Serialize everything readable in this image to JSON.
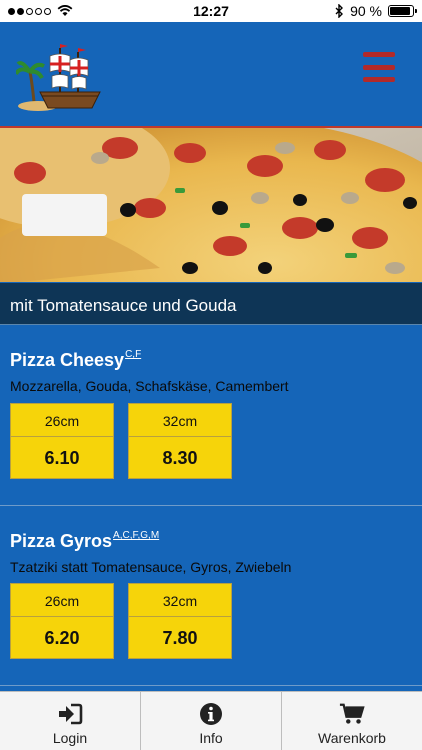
{
  "status_bar": {
    "time": "12:27",
    "battery": "90 %",
    "battery_level": 0.9
  },
  "header": {
    "logo_icon": "pirate-ship-logo",
    "menu_icon": "hamburger-menu-icon"
  },
  "category": {
    "title": "mit Tomatensauce und Gouda"
  },
  "items": [
    {
      "name": "Pizza Cheesy",
      "allergens": "C,F",
      "description": "Mozzarella, Gouda, Schafskäse, Camembert",
      "prices": [
        {
          "size": "26cm",
          "price": "6.10"
        },
        {
          "size": "32cm",
          "price": "8.30"
        }
      ]
    },
    {
      "name": "Pizza Gyros",
      "allergens": "A,C,F,G,M",
      "description": "Tzatziki statt Tomatensauce, Gyros, Zwiebeln",
      "prices": [
        {
          "size": "26cm",
          "price": "6.20"
        },
        {
          "size": "32cm",
          "price": "7.80"
        }
      ]
    }
  ],
  "tabs": [
    {
      "label": "Login",
      "icon": "login-icon"
    },
    {
      "label": "Info",
      "icon": "info-icon"
    },
    {
      "label": "Warenkorb",
      "icon": "cart-icon"
    }
  ],
  "colors": {
    "background": "#1565b8",
    "category_bar": "#0e3556",
    "price_box": "#f6d40a",
    "menu_icon": "#b22a2a"
  }
}
